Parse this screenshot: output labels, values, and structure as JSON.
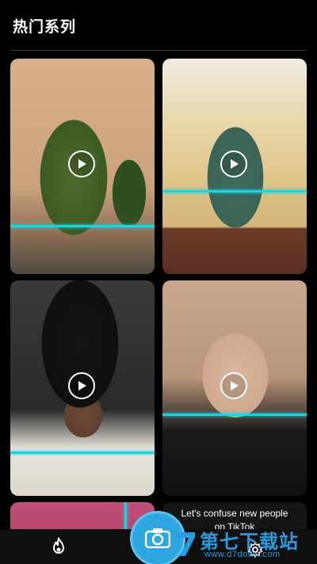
{
  "header": {
    "title": "热门系列"
  },
  "cards": [
    {
      "name": "christmas-tree-1",
      "scanline_fraction": 0.78
    },
    {
      "name": "christmas-tree-2",
      "scanline_fraction": 0.61
    },
    {
      "name": "tall-hair",
      "scanline_fraction": 0.82
    },
    {
      "name": "bald-face",
      "scanline_fraction": 0.62
    }
  ],
  "partial_card": {
    "text": "Let's confuse new people\non TikTok"
  },
  "nav": {
    "home_icon": "flame-icon",
    "camera_icon": "camera-icon",
    "settings_icon": "gear-icon"
  },
  "watermark": {
    "main": "第七下载站",
    "sub": "www.d7down.com"
  },
  "colors": {
    "accent": "#19d4e6",
    "camera": "#2ea6df",
    "watermark": "#2b9be0"
  }
}
